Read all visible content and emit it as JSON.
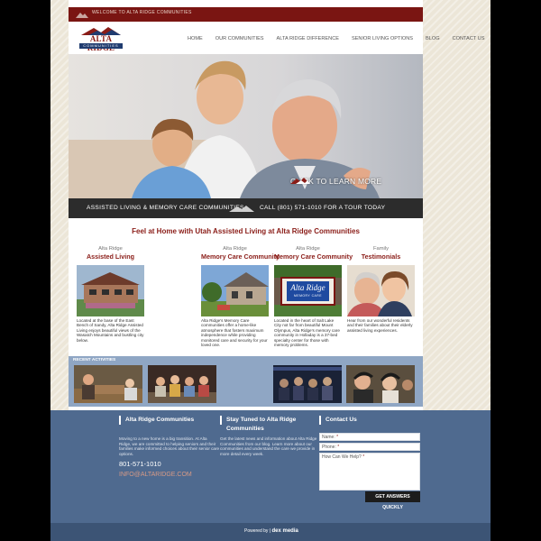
{
  "topbar": {
    "welcome": "Welcome to Alta Ridge Communities"
  },
  "logo": {
    "line1": "ALTA RIDGE",
    "line2": "COMMUNITIES"
  },
  "nav": {
    "items": [
      {
        "label": "HOME"
      },
      {
        "label": "OUR COMMUNITIES"
      },
      {
        "label": "ALTA RIDGE DIFFERENCE"
      },
      {
        "label": "SENIOR LIVING OPTIONS"
      },
      {
        "label": "BLOG"
      },
      {
        "label": "CONTACT US"
      }
    ]
  },
  "hero": {
    "cta": "Click to Learn More"
  },
  "banner": {
    "left": "Assisted Living & Memory Care Communities",
    "right": "Call (801) 571-1010 for a Tour Today"
  },
  "tagline": "Feel at Home with Utah Assisted Living at Alta Ridge Communities",
  "columns": [
    {
      "pre": "Alta Ridge",
      "title": "Assisted Living",
      "desc": "Located at the base of the East Bench of Sandy, Alta Ridge Assisted Living enjoys beautiful views of the Wasatch Mountains and bustling city below.",
      "photo_icon": "building-photo"
    },
    {
      "pre": "Alta Ridge",
      "title": "Memory Care Community",
      "desc": "Alta Ridge's Memory Care communities offer a home-like atmosphere that fosters maximum independence while providing monitored care and security for your loved one.",
      "photo_icon": "house-photo"
    },
    {
      "pre": "Alta Ridge",
      "title": "Memory Care Community",
      "desc": "Located in the heart of Salt Lake City not far from beautiful Mount Olympus, Alta Ridge's memory care community in Holladay is a 37-bed specialty center for those with memory problems.",
      "photo_icon": "sign-photo",
      "sign_text": "Alta Ridge",
      "sign_sub": "MEMORY CARE"
    },
    {
      "pre": "Family",
      "title": "Testimonials",
      "desc": "Hear from our wonderful residents and their families about their elderly assisted living experiences.",
      "photo_icon": "people-photo"
    }
  ],
  "recent": {
    "label": "Recent Activities"
  },
  "footer": {
    "col1": {
      "title": "Alta Ridge Communities",
      "text": "Moving to a new home is a big transition. At Alta Ridge, we are committed to helping seniors and their families make informed choices about their senior care options.",
      "phone": "801-571-1010",
      "email": "INFO@ALTARIDGE.COM"
    },
    "col2": {
      "title": "Stay Tuned to Alta Ridge Communities",
      "text": "Get the latest news and information about Alta Ridge Communities from our blog. Learn more about our communities and understand the care we provide in more detail every week."
    },
    "col3": {
      "title": "Contact Us",
      "name_label": "Name:",
      "phone_label": "Phone:",
      "help_label": "How Can We Help?",
      "required": "*",
      "submit": "Get Answers Quickly"
    }
  },
  "bottom": {
    "powered": "Powered by",
    "brand": "dex media"
  },
  "colors": {
    "brand_red": "#8a1c17",
    "topbar": "#7a1512",
    "footer_blue": "#4f6a8f",
    "recent_bar": "#8fa6c4"
  }
}
